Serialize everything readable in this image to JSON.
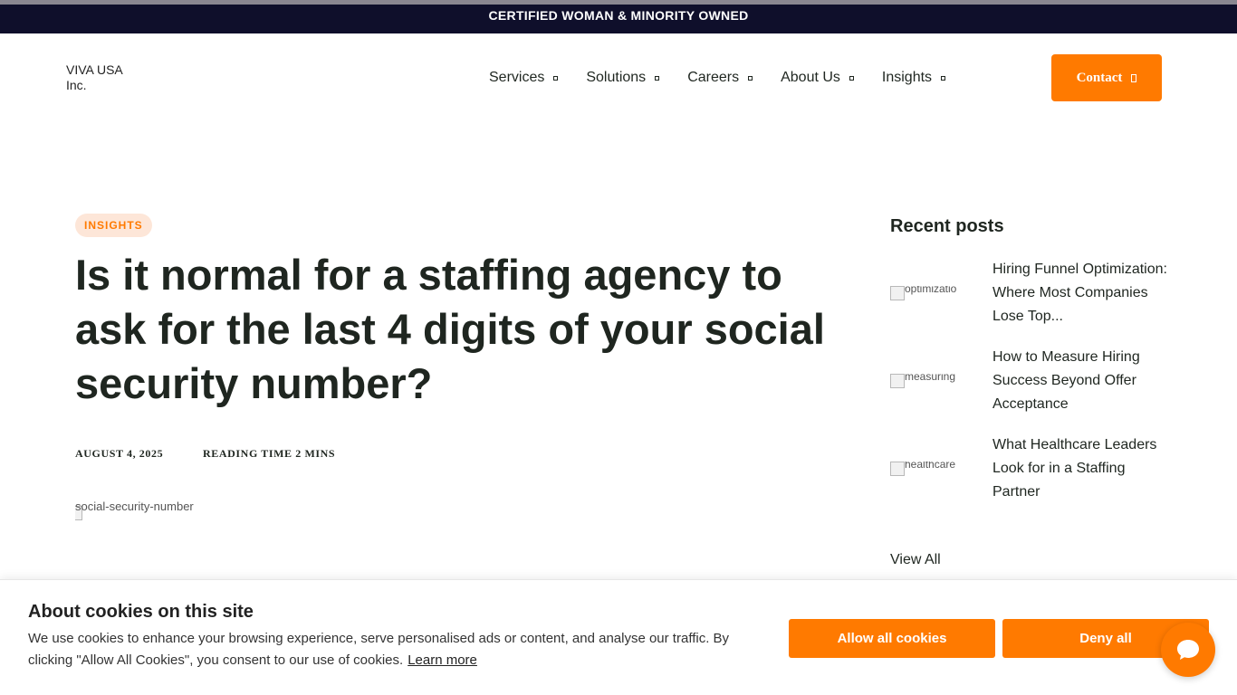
{
  "announcement": "CERTIFIED WOMAN & MINORITY OWNED",
  "logo_alt": "VIVA USA Inc.",
  "nav": {
    "items": [
      {
        "label": "Services"
      },
      {
        "label": "Solutions"
      },
      {
        "label": "Careers"
      },
      {
        "label": "About Us"
      },
      {
        "label": "Insights"
      }
    ],
    "contact_label": "Contact"
  },
  "article": {
    "category": "INSIGHTS",
    "title": "Is it normal for a staffing agency to ask for the last 4 digits of your social security number?",
    "date": "AUGUST 4, 2025",
    "reading_time": "READING TIME 2 MINS",
    "hero_alt": "social-security-number"
  },
  "sidebar": {
    "heading": "Recent posts",
    "posts": [
      {
        "thumb_alt": "optimizatio",
        "title": "Hiring Funnel Optimization: Where Most Companies Lose Top..."
      },
      {
        "thumb_alt": "measuring",
        "title": "How to Measure Hiring Success Beyond Offer Acceptance"
      },
      {
        "thumb_alt": "healthcare",
        "title": "What Healthcare Leaders Look for in a Staffing Partner"
      }
    ],
    "view_all": "View All"
  },
  "cookie": {
    "heading": "About cookies on this site",
    "text": "We use cookies to enhance your browsing experience, serve personalised ads or content, and analyse our traffic. By clicking \"Allow All Cookies\", you consent to our use of cookies.",
    "learn_more": "Learn more",
    "allow_label": "Allow all cookies",
    "deny_label": "Deny all"
  },
  "colors": {
    "accent": "#ff7a00",
    "announcement_bg": "#0f0f2b",
    "badge_bg": "#fde6d8",
    "text": "#1f2620"
  }
}
